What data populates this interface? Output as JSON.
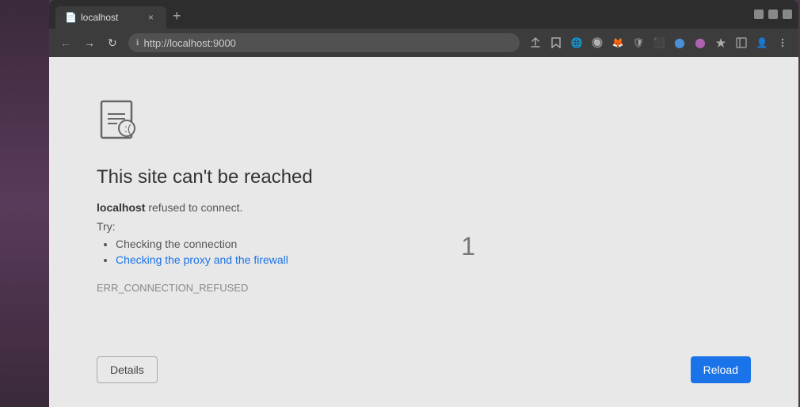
{
  "desktop": {
    "bg_color": "#4a3a4a"
  },
  "browser": {
    "tab": {
      "favicon": "📄",
      "title": "localhost",
      "close_label": "×"
    },
    "new_tab_label": "+",
    "window_controls": {
      "minimize": "—",
      "maximize": "☐",
      "close": "×"
    },
    "toolbar": {
      "back_label": "←",
      "forward_label": "→",
      "reload_label": "↻",
      "address": "http://localhost:9000",
      "address_icon": "ℹ",
      "share_icon": "⤴",
      "bookmark_icon": "☆",
      "extensions_icons": [
        "🌐",
        "🔘",
        "🦊",
        "🔒",
        "🔲",
        "🔵",
        "🟣",
        "✦",
        "☰",
        "⋮"
      ]
    }
  },
  "error_page": {
    "title": "This site can't be reached",
    "subtitle_bold": "localhost",
    "subtitle_rest": " refused to connect.",
    "try_label": "Try:",
    "suggestions": [
      {
        "text": "Checking the connection",
        "link": false
      },
      {
        "text": "Checking the proxy and the firewall",
        "link": true
      }
    ],
    "error_code": "ERR_CONNECTION_REFUSED",
    "page_number": "1",
    "details_button": "Details",
    "reload_button": "Reload"
  }
}
